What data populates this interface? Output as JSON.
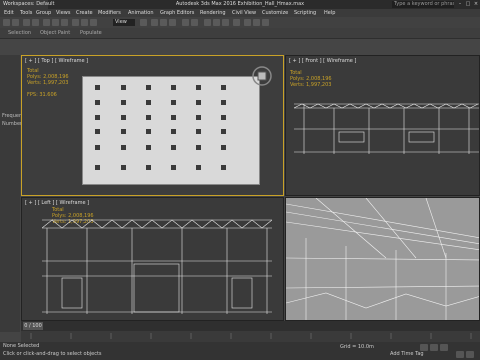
{
  "workspace": "Workspaces: Default",
  "title": "Autodesk 3ds Max 2016   Exhibition_Hall_Hmax.max",
  "search_placeholder": "Type a keyword or phrase",
  "menus": [
    "Edit",
    "Tools",
    "Group",
    "Views",
    "Create",
    "Modifiers",
    "Animation",
    "Graph Editors",
    "Rendering",
    "Civil View",
    "Customize",
    "Scripting",
    "Help"
  ],
  "view_selector": "View",
  "ribbon_tabs": [
    "Selection",
    "Object Paint",
    "Populate"
  ],
  "viewports": {
    "top": {
      "label": "[ + ] [ Top ] [ Wireframe ]",
      "stats_header": "Total",
      "polys": "Polys:   2,008,196",
      "verts": "Verts:   1,997,203",
      "fps": "FPS:    31.606"
    },
    "front": {
      "label": "[ + ] [ Front ] [ Wireframe ]",
      "stats_header": "Total",
      "polys": "Polys:   2,008,196",
      "verts": "Verts:   1,997,203"
    },
    "left": {
      "label": "[ + ] [ Left ] [ Wireframe ]",
      "stats_header": "Total",
      "polys": "Polys:   2,008,196",
      "verts": "Verts:   1,997,203"
    },
    "perspective": {
      "label": ""
    }
  },
  "timeline": {
    "frame_counter": "0 / 100"
  },
  "status": {
    "selection": "None Selected",
    "hint": "Click or click-and-drag to select objects",
    "grid": "Grid = 10.0m",
    "add_time_tag": "Add Time Tag"
  },
  "left_panel": [
    "Frequency",
    "Number"
  ]
}
